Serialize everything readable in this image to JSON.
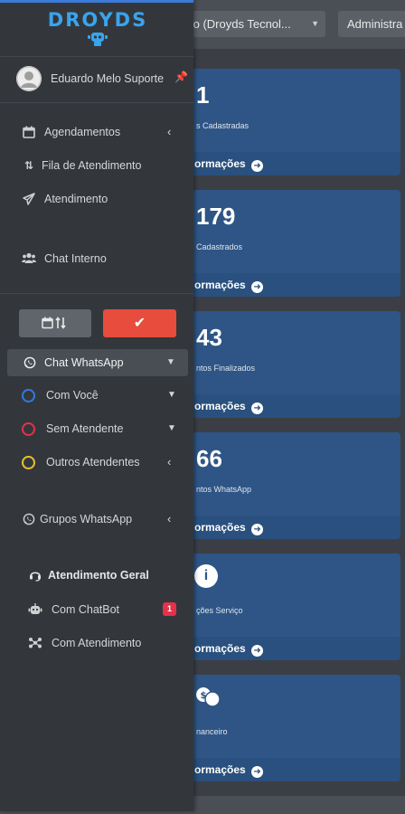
{
  "topbar": {
    "org_select": "to (Droyds Tecnol...",
    "role_select": "Administra"
  },
  "cards": [
    {
      "value": "1",
      "label": "s Cadastradas",
      "footer": "ormações"
    },
    {
      "value": "179",
      "label": " Cadastrados",
      "footer": "ormações"
    },
    {
      "value": "43",
      "label": "ntos Finalizados",
      "footer": "ormações"
    },
    {
      "value": "66",
      "label": "ntos WhatsApp",
      "footer": "ormações"
    },
    {
      "value": "",
      "label": "ções Serviço",
      "footer": "ormações",
      "icon": "info-icon"
    },
    {
      "value": "",
      "label": "nanceiro",
      "footer": "ormações",
      "icon": "money-chat-icon"
    }
  ],
  "sidebar": {
    "brand": "DROYDS",
    "user_name": "Eduardo Melo Suporte",
    "menu": [
      {
        "label": "Agendamentos",
        "icon": "calendar-icon"
      },
      {
        "label": "Fila de Atendimento",
        "icon": "sort-icon"
      },
      {
        "label": "Atendimento",
        "icon": "paper-plane-icon"
      },
      {
        "label": "Chat Interno",
        "icon": "users-icon"
      }
    ],
    "whatsapp": {
      "label": "Chat WhatsApp",
      "items": [
        {
          "label": "Com Você",
          "color": "#2e7be0"
        },
        {
          "label": "Sem Atendente",
          "color": "#e3324a"
        },
        {
          "label": "Outros Atendentes",
          "color": "#e6c229"
        }
      ],
      "groups_label": "Grupos WhatsApp"
    },
    "general": {
      "title": "Atendimento Geral",
      "items": [
        {
          "label": "Com ChatBot",
          "badge": "1"
        },
        {
          "label": "Com Atendimento"
        }
      ]
    }
  },
  "colors": {
    "accent_blue": "#3d7bd9",
    "danger": "#e74c3c",
    "card_bg": "#2e5585",
    "sidebar_bg": "#33373c"
  }
}
